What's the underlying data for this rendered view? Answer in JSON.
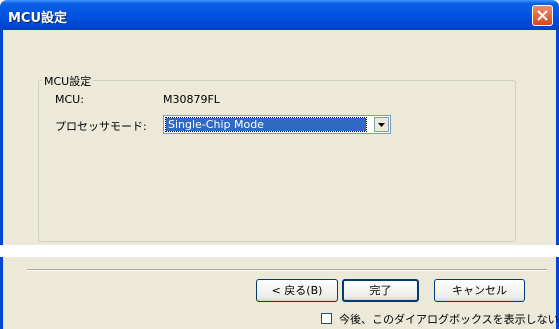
{
  "window": {
    "title": "MCU設定",
    "close_icon": "close-icon"
  },
  "group": {
    "legend": "MCU設定",
    "mcu_label": "MCU:",
    "mcu_value": "M30879FL",
    "mode_label": "プロセッサモード:",
    "mode_selected": "Single-Chip Mode"
  },
  "buttons": {
    "back": "< 戻る(B)",
    "finish": "完了",
    "cancel": "キャンセル"
  },
  "checkbox": {
    "label": "今後、このダイアログボックスを表示しない",
    "checked": false
  },
  "colors": {
    "titlebar": "#0054e3",
    "dialog_bg": "#ece9d8",
    "close": "#d64618",
    "selection": "#316ac5"
  }
}
